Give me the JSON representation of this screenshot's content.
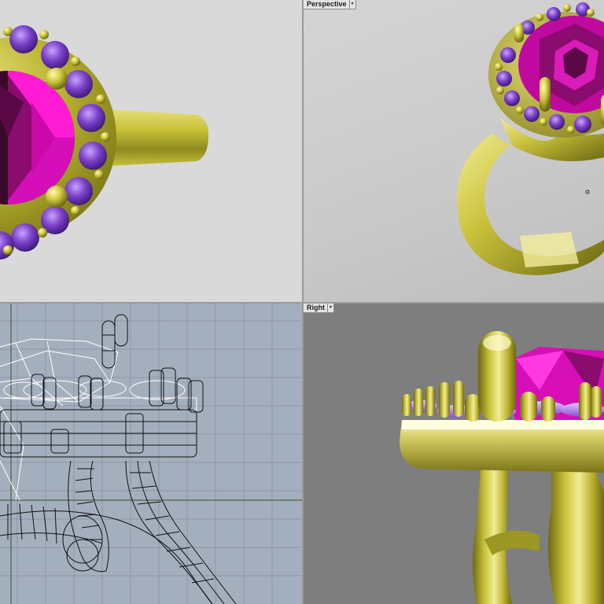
{
  "viewports": {
    "top": {
      "title": ""
    },
    "perspective": {
      "title": "Perspective",
      "menu_icon": "chevron-down-icon"
    },
    "front": {
      "title": ""
    },
    "right": {
      "title": "Right",
      "menu_icon": "chevron-down-icon"
    }
  },
  "colors": {
    "gold": "#c9c23a",
    "ruby": "#e012c0",
    "amethyst": "#7a3fc8",
    "wire_bg": "#a4afbe",
    "persp_bg": "#cccccc",
    "right_bg": "#7e7e7e"
  }
}
